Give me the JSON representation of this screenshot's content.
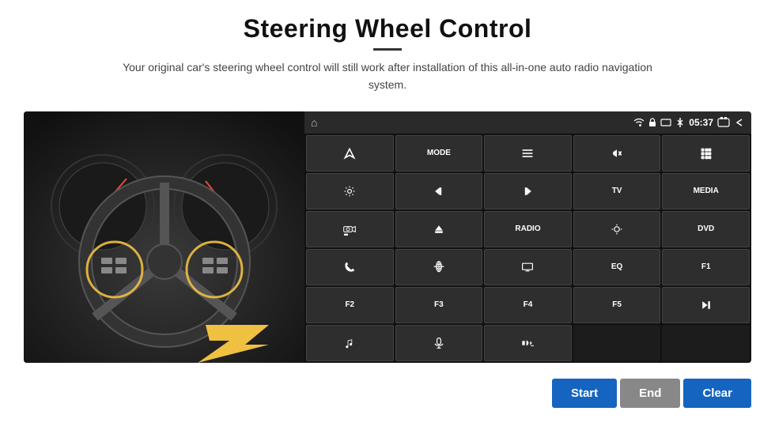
{
  "page": {
    "title": "Steering Wheel Control",
    "subtitle": "Your original car's steering wheel control will still work after installation of this all-in-one auto radio navigation system."
  },
  "status_bar": {
    "time": "05:37"
  },
  "buttons": [
    {
      "id": "b1",
      "type": "icon",
      "icon": "nav",
      "label": ""
    },
    {
      "id": "b2",
      "type": "text",
      "label": "MODE"
    },
    {
      "id": "b3",
      "type": "icon",
      "icon": "list",
      "label": ""
    },
    {
      "id": "b4",
      "type": "icon",
      "icon": "mute",
      "label": ""
    },
    {
      "id": "b5",
      "type": "icon",
      "icon": "apps",
      "label": ""
    },
    {
      "id": "b6",
      "type": "icon",
      "icon": "settings",
      "label": ""
    },
    {
      "id": "b7",
      "type": "icon",
      "icon": "prev",
      "label": ""
    },
    {
      "id": "b8",
      "type": "icon",
      "icon": "next",
      "label": ""
    },
    {
      "id": "b9",
      "type": "text",
      "label": "TV"
    },
    {
      "id": "b10",
      "type": "text",
      "label": "MEDIA"
    },
    {
      "id": "b11",
      "type": "icon",
      "icon": "360cam",
      "label": ""
    },
    {
      "id": "b12",
      "type": "icon",
      "icon": "eject",
      "label": ""
    },
    {
      "id": "b13",
      "type": "text",
      "label": "RADIO"
    },
    {
      "id": "b14",
      "type": "icon",
      "icon": "brightness",
      "label": ""
    },
    {
      "id": "b15",
      "type": "text",
      "label": "DVD"
    },
    {
      "id": "b16",
      "type": "icon",
      "icon": "phone",
      "label": ""
    },
    {
      "id": "b17",
      "type": "icon",
      "icon": "maps",
      "label": ""
    },
    {
      "id": "b18",
      "type": "icon",
      "icon": "display",
      "label": ""
    },
    {
      "id": "b19",
      "type": "text",
      "label": "EQ"
    },
    {
      "id": "b20",
      "type": "text",
      "label": "F1"
    },
    {
      "id": "b21",
      "type": "text",
      "label": "F2"
    },
    {
      "id": "b22",
      "type": "text",
      "label": "F3"
    },
    {
      "id": "b23",
      "type": "text",
      "label": "F4"
    },
    {
      "id": "b24",
      "type": "text",
      "label": "F5"
    },
    {
      "id": "b25",
      "type": "icon",
      "icon": "playpause",
      "label": ""
    },
    {
      "id": "b26",
      "type": "icon",
      "icon": "music",
      "label": ""
    },
    {
      "id": "b27",
      "type": "icon",
      "icon": "mic",
      "label": ""
    },
    {
      "id": "b28",
      "type": "icon",
      "icon": "vol-call",
      "label": ""
    },
    {
      "id": "b29",
      "type": "empty",
      "label": ""
    },
    {
      "id": "b30",
      "type": "empty",
      "label": ""
    }
  ],
  "bottom_buttons": {
    "start": "Start",
    "end": "End",
    "clear": "Clear"
  }
}
